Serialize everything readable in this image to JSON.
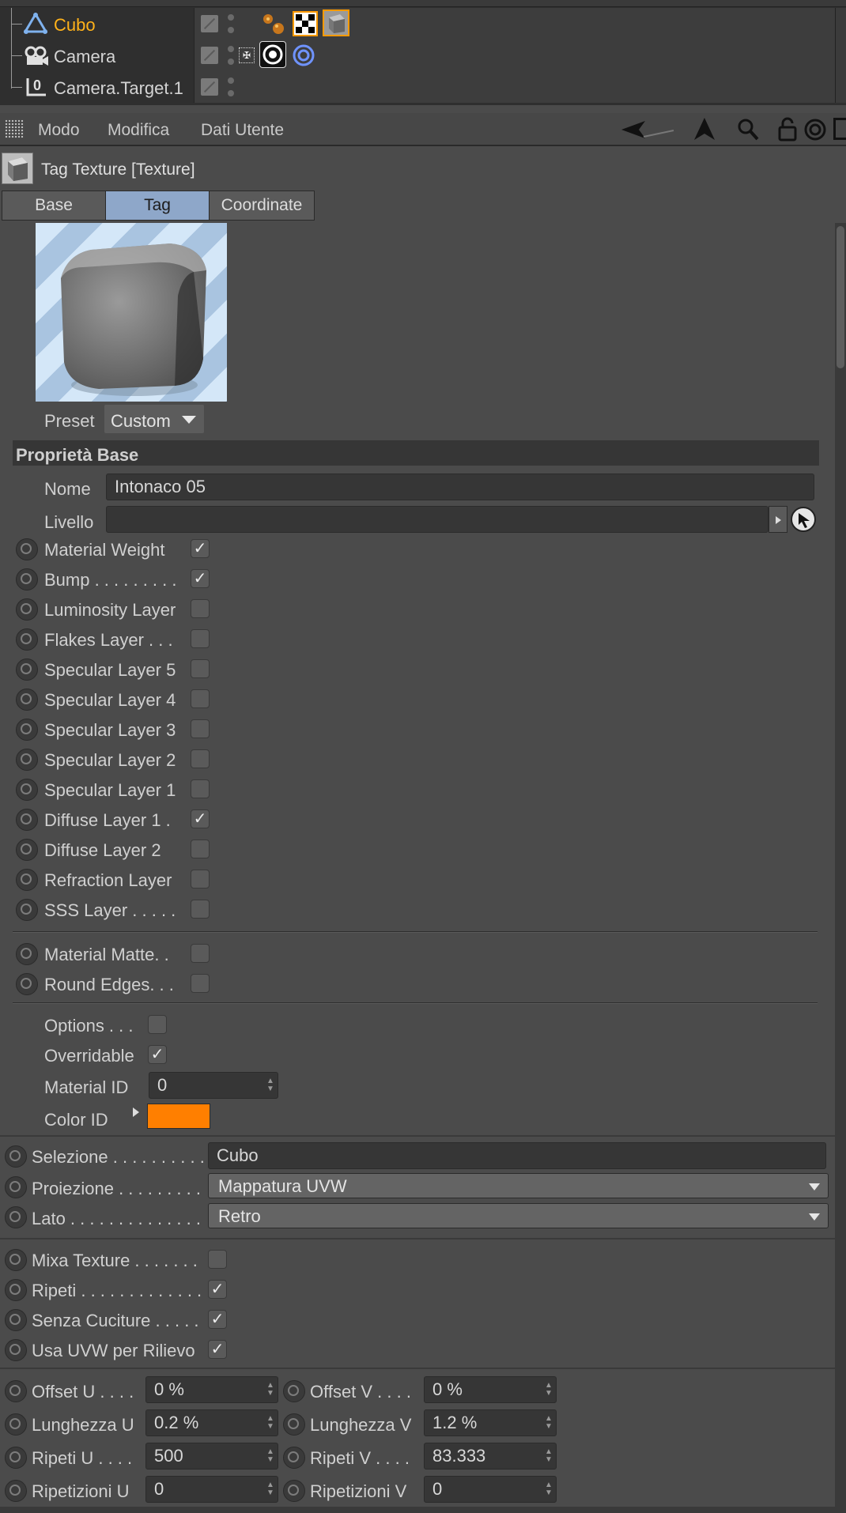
{
  "object_manager": {
    "objects": [
      {
        "name": "Cubo",
        "selected": true
      },
      {
        "name": "Camera",
        "selected": false
      },
      {
        "name": "Camera.Target.1",
        "selected": false
      }
    ]
  },
  "menu": {
    "items": [
      "Modo",
      "Modifica",
      "Dati Utente"
    ]
  },
  "attribute": {
    "title": "Tag Texture [Texture]",
    "tabs": [
      "Base",
      "Tag",
      "Coordinate"
    ],
    "active_tab": "Tag",
    "preset_label": "Preset",
    "preset_value": "Custom",
    "section_title": "Proprietà Base",
    "nome_label": "Nome",
    "nome_value": "Intonaco 05",
    "livello_label": "Livello",
    "layers": [
      {
        "label": "Material Weight",
        "checked": "✓"
      },
      {
        "label": "Bump . . . . . . . . .",
        "checked": "✓"
      },
      {
        "label": "Luminosity Layer",
        "checked": ""
      },
      {
        "label": "Flakes Layer  . . .",
        "checked": ""
      },
      {
        "label": "Specular Layer 5",
        "checked": ""
      },
      {
        "label": "Specular Layer 4",
        "checked": ""
      },
      {
        "label": "Specular Layer 3",
        "checked": ""
      },
      {
        "label": "Specular Layer 2",
        "checked": ""
      },
      {
        "label": "Specular Layer 1",
        "checked": ""
      },
      {
        "label": "Diffuse Layer 1  .",
        "checked": "✓"
      },
      {
        "label": "Diffuse Layer 2",
        "checked": ""
      },
      {
        "label": "Refraction Layer",
        "checked": ""
      },
      {
        "label": "SSS Layer  . . . . .",
        "checked": ""
      }
    ],
    "extra": [
      {
        "label": "Material Matte. .",
        "checked": ""
      },
      {
        "label": "Round Edges. . .",
        "checked": ""
      }
    ],
    "options_label": "Options  . . .",
    "options_checked": "",
    "overridable_label": "Overridable",
    "overridable_checked": "✓",
    "material_id_label": "Material ID",
    "material_id_value": "0",
    "color_id_label": "Color ID",
    "color_id_color": "#ff7f00"
  },
  "tag_props": {
    "selezione_label": "Selezione . . . . . . . . . .",
    "selezione_value": "Cubo",
    "proiezione_label": "Proiezione . . . . . . . . .",
    "proiezione_value": "Mappatura UVW",
    "lato_label": "Lato  . . . . . . . . . . . . . .",
    "lato_value": "Retro",
    "checks": [
      {
        "label": "Mixa Texture . . . . . . .",
        "checked": ""
      },
      {
        "label": "Ripeti . . . . . . . . . . . . .",
        "checked": "✓"
      },
      {
        "label": "Senza Cuciture . . . . .",
        "checked": "✓"
      },
      {
        "label": "Usa UVW per Rilievo",
        "checked": "✓"
      }
    ],
    "params_left": [
      {
        "label": "Offset U . . . .",
        "value": "0 %"
      },
      {
        "label": "Lunghezza U",
        "value": "0.2 %"
      },
      {
        "label": "Ripeti U  . . . .",
        "value": "500"
      },
      {
        "label": "Ripetizioni U",
        "value": "0"
      }
    ],
    "params_right": [
      {
        "label": "Offset V . . . .",
        "value": "0 %"
      },
      {
        "label": "Lunghezza V",
        "value": "1.2 %"
      },
      {
        "label": "Ripeti V  . . . .",
        "value": "83.333"
      },
      {
        "label": "Ripetizioni V",
        "value": "0"
      }
    ]
  }
}
